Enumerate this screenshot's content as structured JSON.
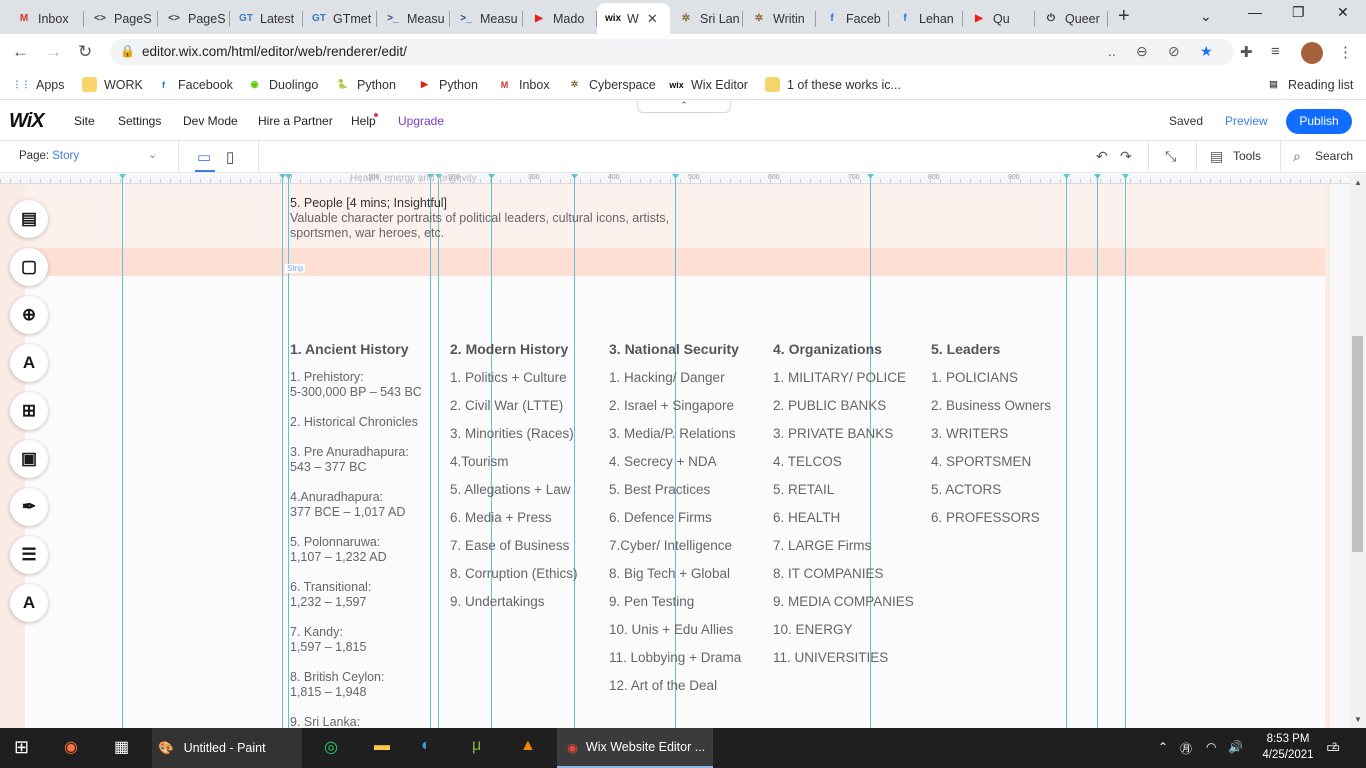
{
  "browser": {
    "tabs": [
      {
        "label": "Inbox",
        "icon": "gmail-icon",
        "glyph": "M",
        "color": "#d93025"
      },
      {
        "label": "PageS",
        "icon": "code-icon",
        "glyph": "<>",
        "color": "#444"
      },
      {
        "label": "PageS",
        "icon": "code-icon",
        "glyph": "<>",
        "color": "#444"
      },
      {
        "label": "Latest",
        "icon": "gtmetrix-icon",
        "glyph": "GT",
        "color": "#3a78c2"
      },
      {
        "label": "GTmet",
        "icon": "gtmetrix-icon",
        "glyph": "GT",
        "color": "#3a78c2"
      },
      {
        "label": "Measu",
        "icon": "powershell-icon",
        "glyph": ">_",
        "color": "#2a4a8c"
      },
      {
        "label": "Measu",
        "icon": "powershell-icon",
        "glyph": ">_",
        "color": "#2a4a8c"
      },
      {
        "label": "Mado",
        "icon": "youtube-icon",
        "glyph": "▶",
        "color": "#e62117"
      },
      {
        "label": "W",
        "icon": "wix-icon",
        "glyph": "wix",
        "color": "#111"
      },
      {
        "label": "Sri Lan",
        "icon": "cyberspace-icon",
        "glyph": "✲",
        "color": "#8a6a3a"
      },
      {
        "label": "Writin",
        "icon": "cyberspace-icon",
        "glyph": "✲",
        "color": "#8a6a3a"
      },
      {
        "label": "Faceb",
        "icon": "facebook-icon",
        "glyph": "f",
        "color": "#1877f2"
      },
      {
        "label": "Lehan",
        "icon": "facebook-icon",
        "glyph": "f",
        "color": "#1877f2"
      },
      {
        "label": "Qu",
        "icon": "youtube-icon",
        "glyph": "▶",
        "color": "#e62117"
      },
      {
        "label": "Queer",
        "icon": "power-icon",
        "glyph": "⏻",
        "color": "#222"
      }
    ],
    "url": "editor.wix.com/html/editor/web/renderer/edit/",
    "bookmarks": [
      {
        "label": "Apps",
        "icon": "apps-grid-icon",
        "glyph": "⋮⋮",
        "color": "#4285f4"
      },
      {
        "label": "WORK",
        "icon": "folder-icon",
        "glyph": "",
        "color": "#f7d56b"
      },
      {
        "label": "Facebook",
        "icon": "facebook-icon",
        "glyph": "f",
        "color": "#1877f2"
      },
      {
        "label": "Duolingo",
        "icon": "duolingo-icon",
        "glyph": "◉",
        "color": "#58cc02"
      },
      {
        "label": "Python",
        "icon": "python-icon",
        "glyph": "🐍",
        "color": "#f5d142"
      },
      {
        "label": "Python",
        "icon": "youtube-icon",
        "glyph": "▶",
        "color": "#e62117"
      },
      {
        "label": "Inbox",
        "icon": "gmail-icon",
        "glyph": "M",
        "color": "#d93025"
      },
      {
        "label": "Cyberspace",
        "icon": "cyberspace-icon",
        "glyph": "✲",
        "color": "#8a6a3a"
      },
      {
        "label": "Wix Editor",
        "icon": "wix-icon",
        "glyph": "wix",
        "color": "#111"
      },
      {
        "label": "1 of these works ic...",
        "icon": "folder-icon",
        "glyph": "",
        "color": "#f7d56b"
      }
    ],
    "reading_list": "Reading list"
  },
  "wix": {
    "logo": "WiX",
    "menu": [
      "Site",
      "Settings",
      "Dev Mode",
      "Hire a Partner",
      "Help"
    ],
    "upgrade": "Upgrade",
    "saved": "Saved",
    "preview": "Preview",
    "publish": "Publish",
    "page_label": "Page:",
    "page_name": "Story",
    "tools": "Tools",
    "search": "Search",
    "strip_label": "Strip"
  },
  "ruler": [
    "0",
    "100",
    "200",
    "300",
    "400",
    "500",
    "600",
    "700",
    "800",
    "900"
  ],
  "content": {
    "ghost_text": "Health, energy and longevity",
    "people_title": "5. People [4 mins; Insightful]",
    "people_desc": "Valuable character portraits of political leaders, cultural icons, artists, sportsmen, war heroes, etc.",
    "columns": [
      {
        "title": "1. Ancient History",
        "items": [
          {
            "a": "1. Prehistory:",
            "b": "5-300,000 BP – 543 BC"
          },
          {
            "a": "2. Historical Chronicles",
            "b": ""
          },
          {
            "a": "3. Pre Anuradhapura:",
            "b": "543 – 377 BC"
          },
          {
            "a": "4.Anuradhapura:",
            "b": "377 BCE – 1,017 AD"
          },
          {
            "a": "5. Polonnaruwa:",
            "b": "1,107 – 1,232 AD"
          },
          {
            "a": "6. Transitional:",
            "b": "1,232 – 1,597"
          },
          {
            "a": "7. Kandy:",
            "b": "1,597 – 1,815"
          },
          {
            "a": "8. British Ceylon:",
            "b": "1,815 – 1,948"
          },
          {
            "a": "9. Sri Lanka:",
            "b": ""
          }
        ]
      },
      {
        "title": "2. Modern History",
        "items": [
          "1. Politics + Culture",
          "2. Civil War (LTTE)",
          "3. Minorities (Races)",
          "4.Tourism",
          "5. Allegations + Law",
          "6. Media + Press",
          "7. Ease of Business",
          "8. Corruption (Ethics)",
          "9. Undertakings"
        ]
      },
      {
        "title": "3. National Security",
        "items": [
          "1. Hacking/ Danger",
          "2. Israel + Singapore",
          "3. Media/P. Relations",
          "4. Secrecy + NDA",
          "5. Best Practices",
          "6. Defence Firms",
          "7.Cyber/ Intelligence",
          "8. Big Tech + Global",
          "9. Pen Testing",
          "10. Unis + Edu Allies",
          "11. Lobbying + Drama",
          "12. Art of the Deal"
        ]
      },
      {
        "title": "4. Organizations",
        "items": [
          "1. MILITARY/ POLICE",
          "2. PUBLIC BANKS",
          "3. PRIVATE BANKS",
          "4. TELCOS",
          "5. RETAIL",
          "6. HEALTH",
          "7. LARGE Firms",
          "8. IT COMPANIES",
          "9. MEDIA COMPANIES",
          "10. ENERGY",
          "11. UNIVERSITIES"
        ]
      },
      {
        "title": "5. Leaders",
        "items": [
          "1. POLICIANS",
          "2. Business Owners",
          "3. WRITERS",
          "4. SPORTSMEN",
          "5. ACTORS",
          "6. PROFESSORS"
        ]
      }
    ]
  },
  "taskbar": {
    "paint_label": "Untitled - Paint",
    "chrome_label": "Wix Website Editor ...",
    "time": "8:53 PM",
    "date": "4/25/2021",
    "notif_count": "2"
  }
}
